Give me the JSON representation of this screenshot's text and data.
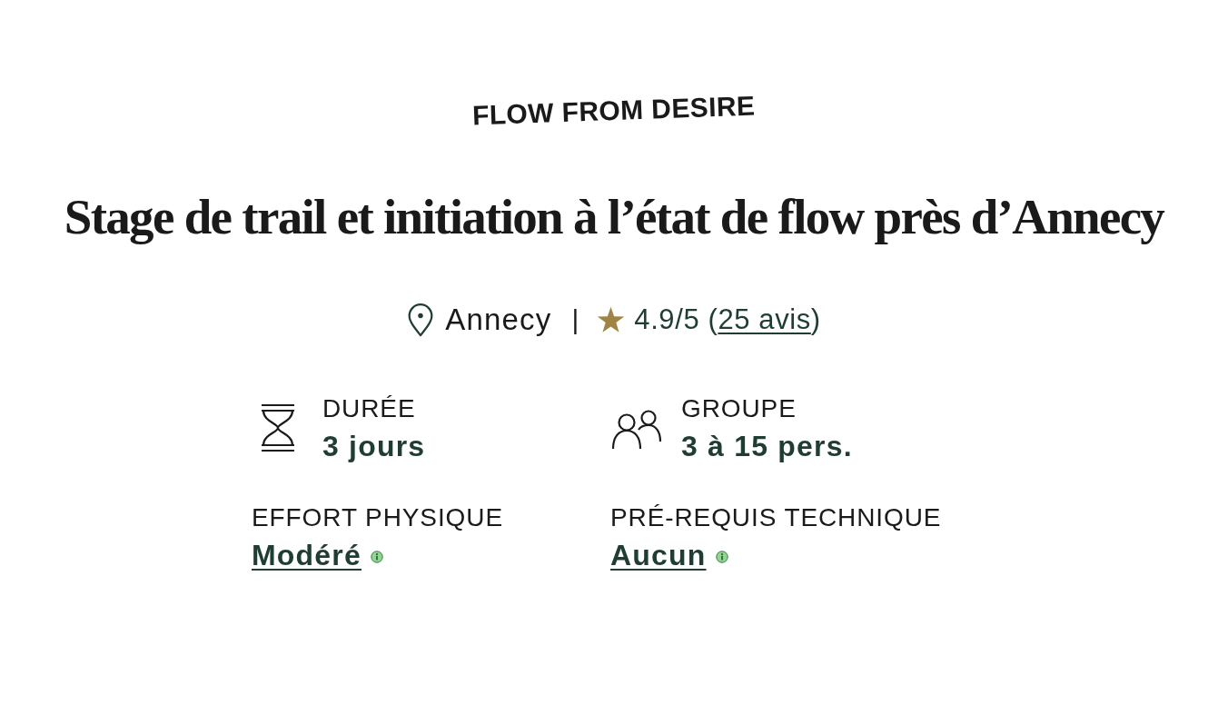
{
  "brand": "FLOW FROM DESIRE",
  "title": "Stage de trail et initiation à l’état de flow près d’Annecy",
  "meta": {
    "location": "Annecy",
    "separator": "|",
    "score": "4.9/5",
    "reviews": {
      "before": "(",
      "link": "25 avis",
      "after": ")"
    }
  },
  "facts": [
    {
      "kind": "duration",
      "label": "DURÉE",
      "value": "3 jours"
    },
    {
      "kind": "group",
      "label": "GROUPE",
      "value": "3 à 15 pers."
    },
    {
      "kind": "level",
      "label": "EFFORT PHYSIQUE",
      "value": "Modéré"
    },
    {
      "kind": "level",
      "label": "PRÉ-REQUIS TECHNIQUE",
      "value": "Aucun"
    }
  ]
}
